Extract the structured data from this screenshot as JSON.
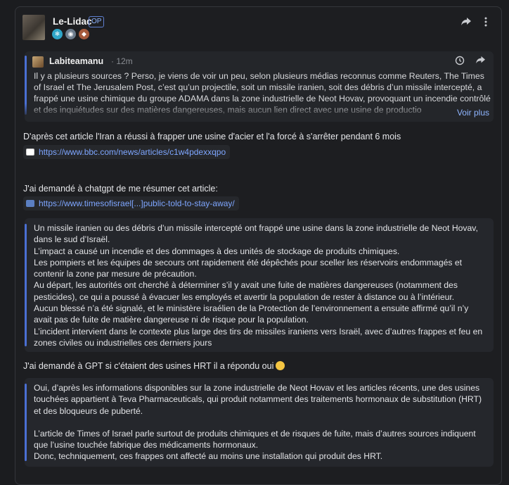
{
  "post": {
    "author": "Le-Lidac",
    "op_badge": "OP",
    "badges": [
      "frost-badge",
      "gadget-badge",
      "shield-badge"
    ],
    "quote": {
      "author": "Labiteamanu",
      "time": "· 12m",
      "text": "Il y a plusieurs sources ? Perso, je viens de voir un peu, selon plusieurs médias reconnus comme Reuters, The Times of Israel et The Jerusalem Post, c’est qu’un projectile, soit un missile iranien, soit des débris d’un missile intercepté, a frappé une usine chimique du groupe ADAMA dans la zone industrielle de Neot Hovav, provoquant un incendie contrôlé et des inquiétudes sur des matières dangereuses, mais aucun lien direct avec une usine de productio",
      "more": "Voir plus"
    },
    "para1": "D'après cet article l'Iran a réussi à frapper une usine d'acier et l'a forcé à s'arrêter pendant 6 mois",
    "link1": "https://www.bbc.com/news/articles/c1w4pdexxqpo",
    "para2": "J'ai demandé à chatgpt de me résumer cet article:",
    "link2": "https://www.timesofisrael[...]public-told-to-stay-away/",
    "summary": [
      "Un missile iranien ou des débris d’un missile intercepté ont frappé une usine dans la zone industrielle de Neot Hovav, dans le sud d’Israël.",
      "L’impact a causé un incendie et des dommages à des unités de stockage de produits chimiques.",
      "Les pompiers et les équipes de secours ont rapidement été dépêchés pour sceller les réservoirs endommagés et contenir la zone par mesure de précaution.",
      "Au départ, les autorités ont cherché à déterminer s’il y avait une fuite de matières dangereuses (notamment des pesticides), ce qui a poussé à évacuer les employés et avertir la population de rester à distance ou à l’intérieur.",
      "Aucun blessé n’a été signalé, et le ministère israélien de la Protection de l’environnement a ensuite affirmé qu’il n’y avait pas de fuite de matière dangereuse ni de risque pour la population.",
      "L’incident intervient dans le contexte plus large des tirs de missiles iraniens vers Israël, avec d’autres frappes et feu en zones civiles ou industrielles ces derniers jours"
    ],
    "para3": "J'ai demandé à GPT si c'étaient des usines HRT il a répondu oui",
    "answer": [
      "Oui, d’après les informations disponibles sur la zone industrielle de Neot Hovav et les articles récents, une des usines touchées appartient à Teva Pharmaceuticals, qui produit notamment des traitements hormonaux de substitution (HRT) et des bloqueurs de puberté.",
      "",
      "L’article de Times of Israel parle surtout de produits chimiques et de risques de fuite, mais d’autres sources indiquent que l’usine touchée fabrique des médicaments hormonaux.",
      "Donc, techniquement, ces frappes ont affecté au moins une installation qui produit des HRT."
    ]
  },
  "icons": {
    "share": "share-arrow-icon",
    "more": "more-vertical-icon",
    "history": "history-icon",
    "quote_share": "share-arrow-icon"
  }
}
